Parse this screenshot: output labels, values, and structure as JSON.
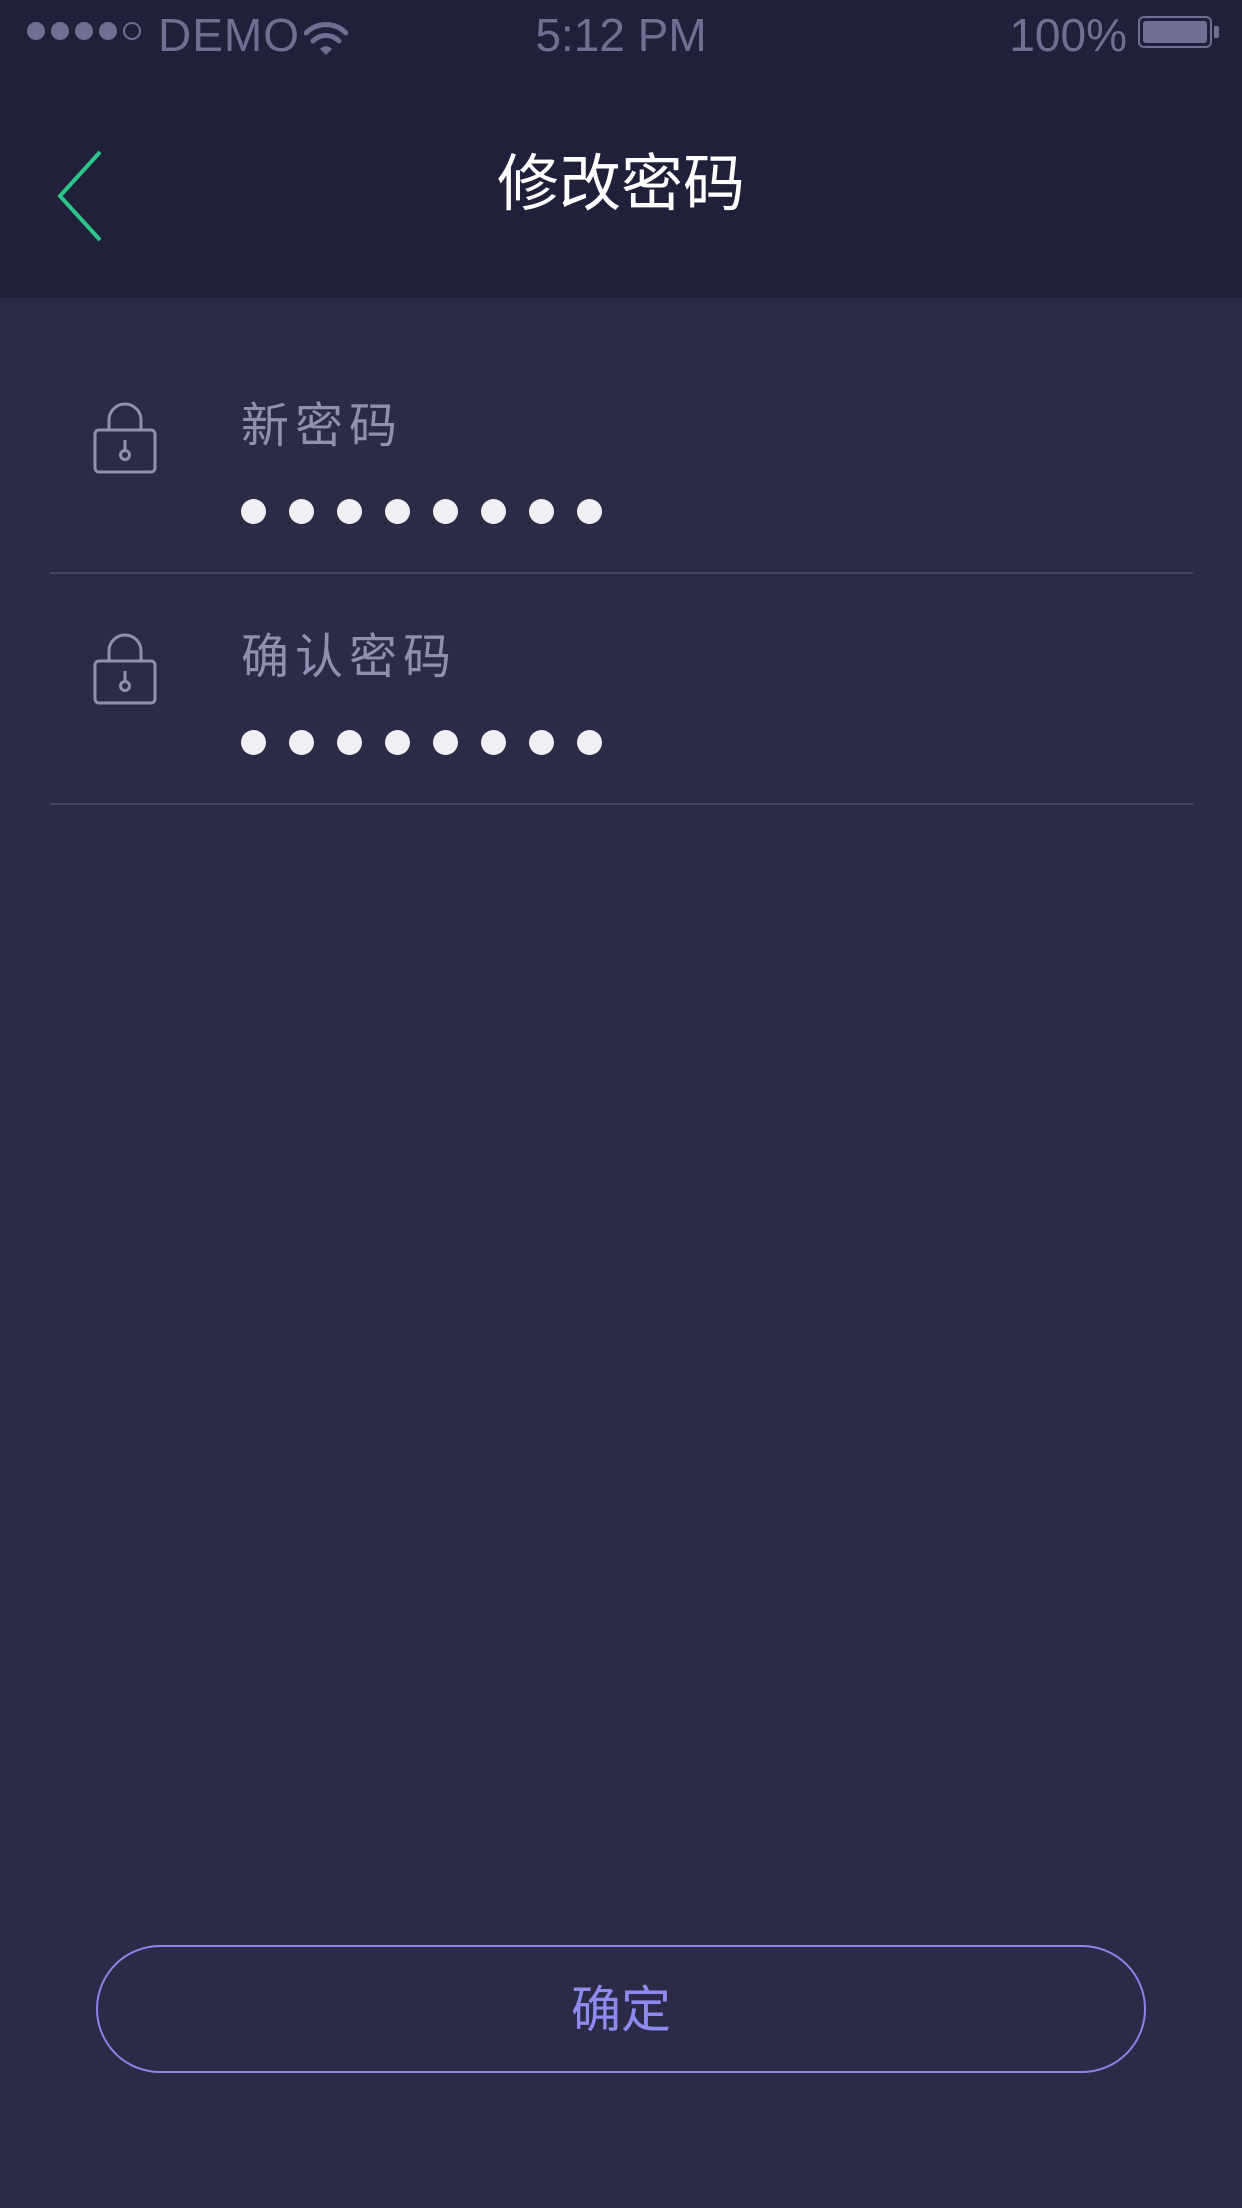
{
  "status_bar": {
    "carrier": "DEMO",
    "time": "5:12 PM",
    "battery_percent": "100%",
    "signal_strength": 4,
    "signal_max": 5,
    "battery_level": 1.0
  },
  "navbar": {
    "title": "修改密码",
    "back_icon": "chevron-left-icon"
  },
  "form": {
    "fields": [
      {
        "label": "新密码",
        "value": "••••••••",
        "icon": "lock-icon"
      },
      {
        "label": "确认密码",
        "value": "••••••••",
        "icon": "lock-icon"
      }
    ]
  },
  "actions": {
    "confirm_label": "确定"
  },
  "colors": {
    "background": "#2b2b47",
    "header": "#20203a",
    "accent_green": "#2ec58a",
    "button_outline": "#8a84e8",
    "label_text": "#8f8fb0"
  }
}
